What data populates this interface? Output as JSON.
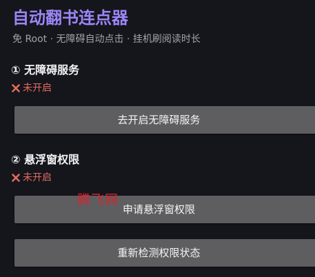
{
  "app": {
    "title": "自动翻书连点器",
    "subtitle": "免 Root · 无障碍自动点击 · 挂机刷阅读时长"
  },
  "sections": [
    {
      "title": "① 无障碍服务",
      "status_icon": "cross-mark-icon",
      "status": "未开启",
      "button_label": "去开启无障碍服务"
    },
    {
      "title": "② 悬浮窗权限",
      "status_icon": "cross-mark-icon",
      "status": "未开启",
      "button_label": "申请悬浮窗权限"
    }
  ],
  "recheck_button_label": "重新检测权限状态",
  "watermark": "腾飞网",
  "colors": {
    "background": "#15151c",
    "title": "#9b86f5",
    "status_off": "#e26b5d",
    "button": "#5e5e61",
    "watermark": "#d8232b"
  }
}
